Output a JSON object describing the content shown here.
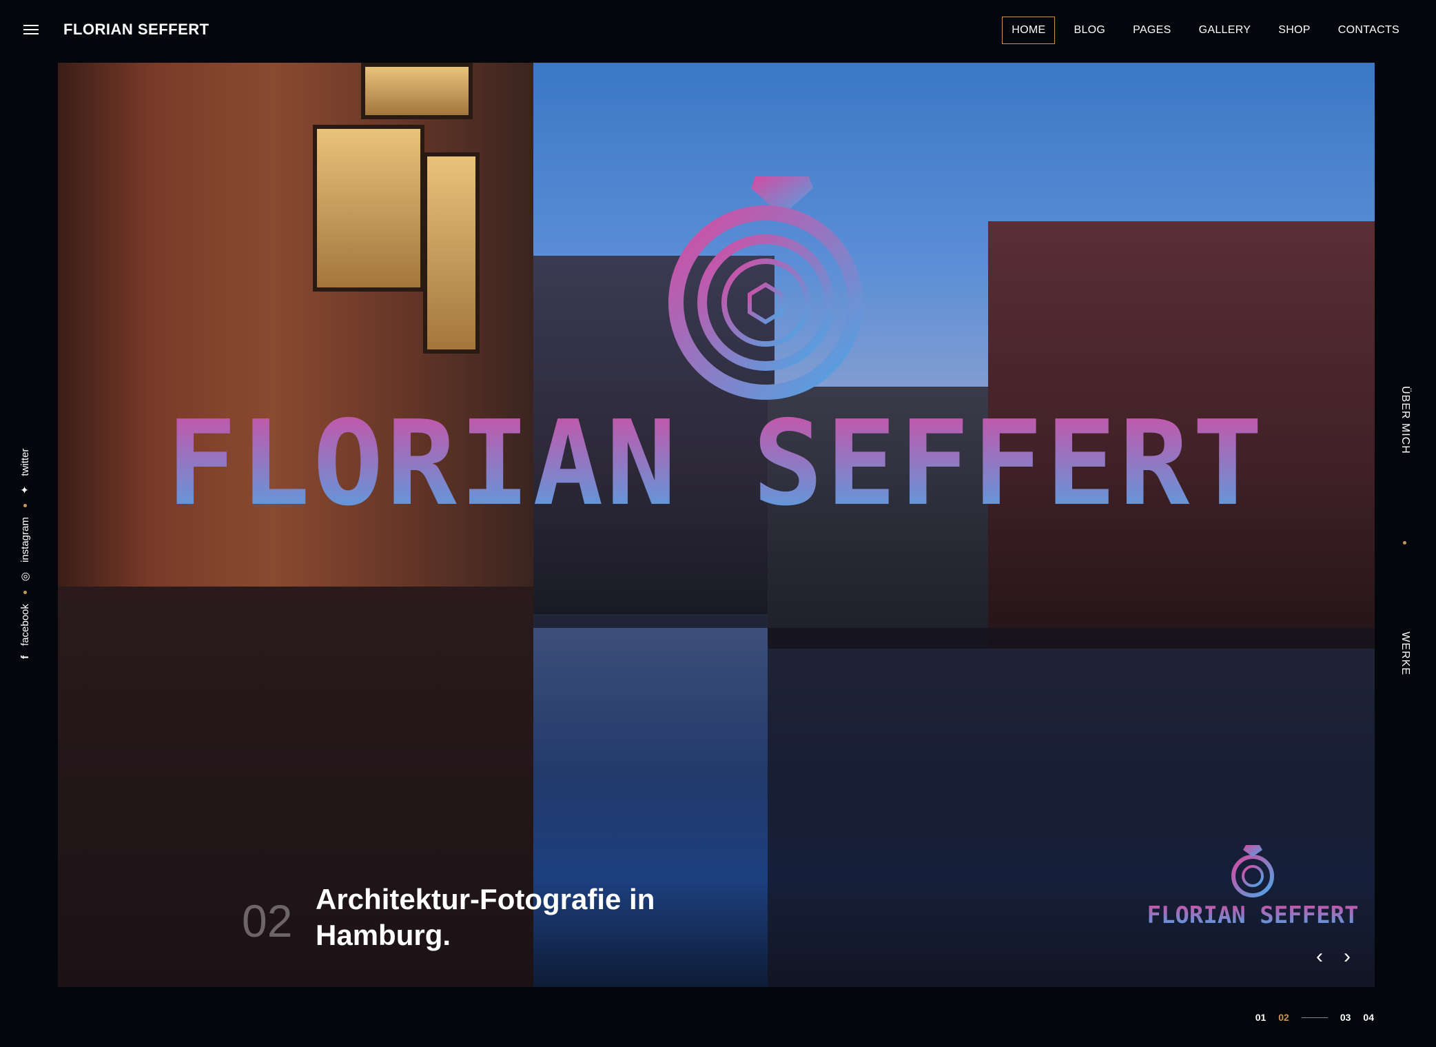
{
  "brand": "FLORIAN SEFFERT",
  "nav": [
    {
      "label": "HOME",
      "active": true
    },
    {
      "label": "BLOG"
    },
    {
      "label": "PAGES"
    },
    {
      "label": "GALLERY"
    },
    {
      "label": "SHOP"
    },
    {
      "label": "CONTACTS"
    }
  ],
  "social": [
    "facebook",
    "instagram",
    "twitter"
  ],
  "side_right": [
    "WERKE",
    "ÜBER MICH"
  ],
  "hero": {
    "logo_text": "FLORIAN SEFFERT",
    "slide_number": "02",
    "slide_title": "Architektur-Fotografie in Hamburg.",
    "watermark_text": "FLORIAN SEFFERT"
  },
  "pager": [
    "01",
    "02",
    "03",
    "04"
  ],
  "colors": {
    "accent": "#c8945a",
    "logo_pink": "#d64aa0",
    "logo_blue": "#4aa8e6",
    "background": "#03070b"
  },
  "icons": {
    "menu": "hamburger-icon",
    "prev": "chevron-left-icon",
    "next": "chevron-right-icon",
    "facebook": "facebook-icon",
    "instagram": "instagram-icon",
    "twitter": "twitter-icon"
  }
}
